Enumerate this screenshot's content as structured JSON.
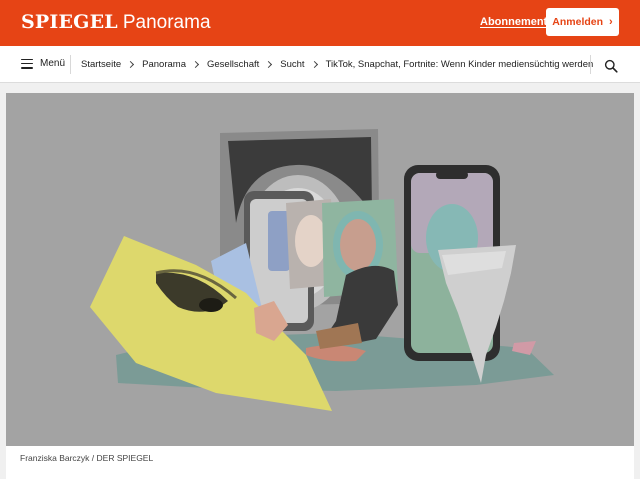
{
  "header": {
    "brand_logo": "SPIEGEL",
    "brand_section": "Panorama",
    "subscription_link": "Abonnement",
    "login_button": "Anmelden",
    "accent_color": "#e64415"
  },
  "nav": {
    "menu_label": "Menü",
    "breadcrumbs": [
      "Startseite",
      "Panorama",
      "Gesellschaft",
      "Sucht"
    ],
    "current_page": "TikTok, Snapchat, Fortnite: Wenn Kinder mediensüchtig werden",
    "icons": [
      "hamburger-icon",
      "chevron-right-icon",
      "search-icon"
    ]
  },
  "article": {
    "image_credit": "Franziska Barczyk / DER SPIEGEL",
    "image_icons": [
      "collage-illustration"
    ]
  }
}
